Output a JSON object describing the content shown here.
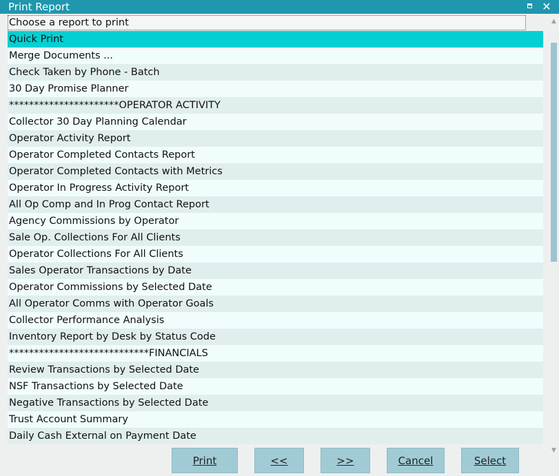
{
  "window": {
    "title": "Print Report",
    "maximize_icon": "maximize-icon",
    "close_glyph": "✕"
  },
  "list": {
    "header": "Choose a report to print",
    "selected_index": 0,
    "items": [
      "Quick Print",
      "Merge Documents ...",
      "Check Taken by Phone - Batch",
      "30 Day Promise Planner",
      "**********************OPERATOR ACTIVITY",
      "Collector 30 Day Planning Calendar",
      "Operator Activity Report",
      "Operator Completed Contacts Report",
      "Operator Completed Contacts with Metrics",
      "Operator In Progress Activity Report",
      "All Op Comp and In Prog Contact Report",
      "Agency Commissions by Operator",
      "Sale Op. Collections For All Clients",
      "Operator Collections For All Clients",
      "Sales Operator Transactions by Date",
      "Operator Commissions by Selected Date",
      "All Operator Comms with Operator Goals",
      "Collector Performance Analysis",
      "Inventory Report by Desk by Status Code",
      "****************************FINANCIALS",
      "Review Transactions by Selected Date",
      "NSF Transactions by Selected Date",
      "Negative Transactions by Selected Date",
      "Trust Account Summary",
      "Daily Cash External on Payment Date"
    ]
  },
  "buttons": {
    "print": "Print",
    "prev": "<<",
    "next": ">>",
    "cancel": "Cancel",
    "select": "Select"
  },
  "colors": {
    "titlebar": "#1f97ae",
    "selected_row": "#06cfd3",
    "row_odd": "#e1eeee",
    "row_even": "#f1fcfd",
    "button": "#a0cbd5",
    "scroll_thumb": "#9cc4cf"
  }
}
